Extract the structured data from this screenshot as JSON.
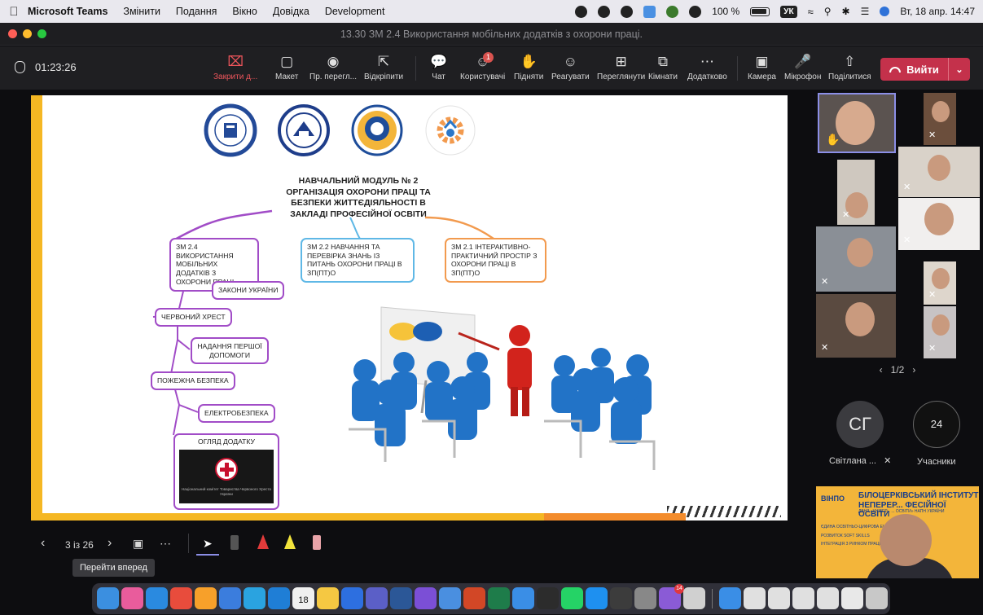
{
  "menubar": {
    "app_name": "Microsoft Teams",
    "menus": [
      "Змінити",
      "Подання",
      "Вікно",
      "Довідка",
      "Development"
    ],
    "battery": "100 %",
    "keyboard": "УК",
    "datetime": "Вт, 18 апр.  14:47"
  },
  "window": {
    "title": "13.30 ЗМ 2.4 Використання мобільних додатків з охорони праці."
  },
  "toolbar": {
    "timer": "01:23:26",
    "buttons": [
      {
        "label": "Закрити д...",
        "icon": "close-share-icon"
      },
      {
        "label": "Макет",
        "icon": "layout-icon"
      },
      {
        "label": "Пр. перегл...",
        "icon": "eye-icon"
      },
      {
        "label": "Відкріпити",
        "icon": "popout-icon"
      },
      {
        "label": "Чат",
        "icon": "chat-icon"
      },
      {
        "label": "Користувачі",
        "icon": "people-icon"
      },
      {
        "label": "Підняти",
        "icon": "hand-icon"
      },
      {
        "label": "Реагувати",
        "icon": "smile-icon"
      },
      {
        "label": "Переглянути",
        "icon": "grid-icon"
      },
      {
        "label": "Кімнати",
        "icon": "rooms-icon"
      },
      {
        "label": "Додатково",
        "icon": "more-icon"
      },
      {
        "label": "Камера",
        "icon": "camera-icon"
      },
      {
        "label": "Мікрофон",
        "icon": "mic-icon"
      },
      {
        "label": "Поділитися",
        "icon": "share-icon"
      }
    ],
    "people_badge": "1",
    "leave_label": "Вийти"
  },
  "slide": {
    "module_title": "НАВЧАЛЬНИЙ МОДУЛЬ № 2 ОРГАНІЗАЦІЯ ОХОРОНИ ПРАЦІ ТА БЕЗПЕКИ ЖИТТЄДІЯЛЬНОСТІ В ЗАКЛАДІ ПРОФЕСІЙНОЇ ОСВІТИ",
    "zm24": "ЗМ 2.4 ВИКОРИСТАННЯ МОБІЛЬНИХ ДОДАТКІВ З ОХОРОНИ ПРАЦІ",
    "zm22": "ЗМ 2.2 НАВЧАННЯ ТА ПЕРЕВІРКА ЗНАНЬ ІЗ ПИТАНЬ ОХОРОНИ ПРАЦІ В ЗП(ПТ)О",
    "zm21": "ЗМ 2.1 ІНТЕРАКТИВНО-ПРАКТИЧНИЙ ПРОСТІР З ОХОРОНИ ПРАЦІ В ЗП(ПТ)О",
    "subnodes": [
      "ЗАКОНИ УКРАЇНИ",
      "ЧЕРВОНИЙ ХРЕСТ",
      "НАДАННЯ ПЕРШОЇ ДОПОМОГИ",
      "ПОЖЕЖНА БЕЗПЕКА",
      "ЕЛЕКТРОБЕЗПЕКА"
    ],
    "app_review": "ОГЛЯД ДОДАТКУ",
    "app_caption": "Національний комітет Товариства Червоного Хреста України"
  },
  "gallery": {
    "page": "1/2",
    "participant_initials": "СГ",
    "participant_name": "Світлана ...",
    "participants_count": "24",
    "participants_label": "Учасники"
  },
  "camera_feed": {
    "logo_text": "ВІНПО",
    "title": "БІЛОЦЕРКІВСЬКИЙ ІНСТИТУТ НЕПЕРЕР... ФЕСІЙНОЇ ОСВІТИ",
    "subtitle": "ДВНЗ «УНІВЕР... ... ОСВІТИ» НАПН УКРАЇНИ",
    "items": [
      "ЄДИНА ОСВІТНЬО-ЦИФРОВА ЕКОСИСТЕМА",
      "РОЗВИТОК SOFT SKILLS",
      "ІНТЕГРАЦІЯ З РИНКОМ ПРАЦІ"
    ]
  },
  "slide_controls": {
    "page": "3 із 26",
    "tooltip": "Перейти вперед"
  },
  "dock": {
    "calendar_day": "18",
    "badge": "14"
  },
  "colors": {
    "leave": "#c4314b",
    "accent_yellow": "#f5b723",
    "mindmap_purple": "#a14cc7",
    "mindmap_blue": "#5fb8e6",
    "mindmap_orange": "#f29a4e"
  }
}
